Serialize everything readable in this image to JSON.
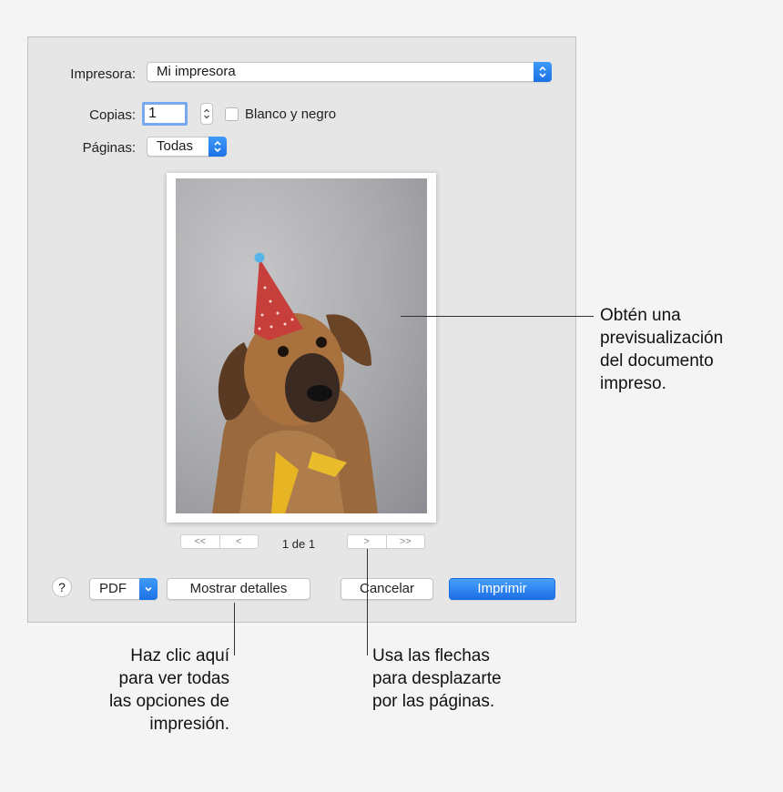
{
  "dialog": {
    "printer_label": "Impresora:",
    "printer_value": "Mi impresora",
    "copies_label": "Copias:",
    "copies_value": "1",
    "bw_label": "Blanco y negro",
    "pages_label": "Páginas:",
    "pages_value": "Todas",
    "page_indicator": "1 de 1",
    "nav_first": "<<",
    "nav_prev": "<",
    "nav_next": ">",
    "nav_last": ">>",
    "help_label": "?",
    "pdf_label": "PDF",
    "details_label": "Mostrar detalles",
    "cancel_label": "Cancelar",
    "print_label": "Imprimir"
  },
  "callouts": {
    "preview": [
      "Obtén una",
      "previsualización",
      "del documento",
      "impreso."
    ],
    "details": [
      "Haz clic aquí",
      "para ver todas",
      "las opciones de",
      "impresión."
    ],
    "arrows": [
      "Usa las flechas",
      "para desplazarte",
      "por las páginas."
    ]
  },
  "colors": {
    "accent": "#1d6fe6",
    "dialog_bg": "#e6e6e6"
  },
  "icons": [
    "chevron-updown-icon",
    "chevron-down-icon",
    "help-icon"
  ]
}
